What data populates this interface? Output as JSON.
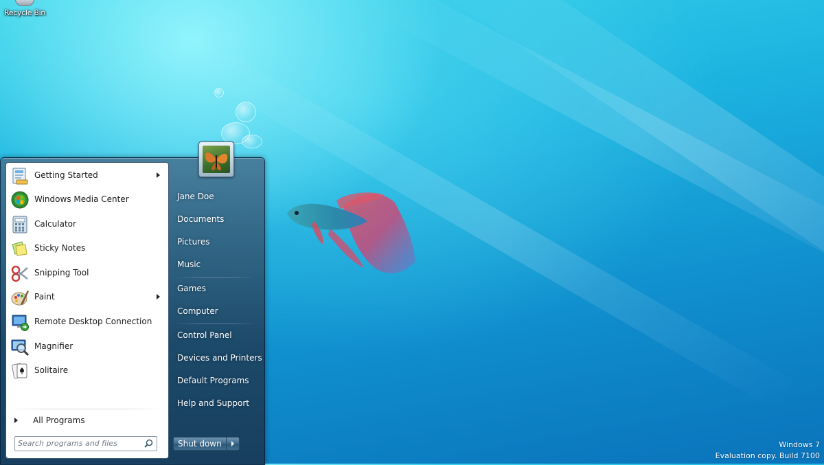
{
  "desktop": {
    "recycle_bin_label": "Recycle Bin",
    "watermark_line1": "Windows 7",
    "watermark_line2": "Evaluation copy. Build 7100"
  },
  "start_menu": {
    "programs": [
      {
        "label": "Getting Started",
        "icon": "getting-started-icon",
        "has_submenu": true
      },
      {
        "label": "Windows Media Center",
        "icon": "windows-media-center-icon",
        "has_submenu": false
      },
      {
        "label": "Calculator",
        "icon": "calculator-icon",
        "has_submenu": false
      },
      {
        "label": "Sticky Notes",
        "icon": "sticky-notes-icon",
        "has_submenu": false
      },
      {
        "label": "Snipping Tool",
        "icon": "snipping-tool-icon",
        "has_submenu": false
      },
      {
        "label": "Paint",
        "icon": "paint-icon",
        "has_submenu": true
      },
      {
        "label": "Remote Desktop Connection",
        "icon": "remote-desktop-icon",
        "has_submenu": false
      },
      {
        "label": "Magnifier",
        "icon": "magnifier-icon",
        "has_submenu": false
      },
      {
        "label": "Solitaire",
        "icon": "solitaire-icon",
        "has_submenu": false
      }
    ],
    "all_programs_label": "All Programs",
    "search": {
      "placeholder": "Search programs and files"
    },
    "right_items": [
      {
        "label": "Jane Doe"
      },
      {
        "label": "Documents"
      },
      {
        "label": "Pictures"
      },
      {
        "label": "Music"
      },
      {
        "label": "Games"
      },
      {
        "label": "Computer"
      },
      {
        "label": "Control Panel"
      },
      {
        "label": "Devices and Printers"
      },
      {
        "label": "Default Programs"
      },
      {
        "label": "Help and Support"
      }
    ],
    "shutdown_label": "Shut down"
  },
  "colors": {
    "desktop_accent": "#1cb2e0",
    "menu_glass": "#2e5978"
  }
}
